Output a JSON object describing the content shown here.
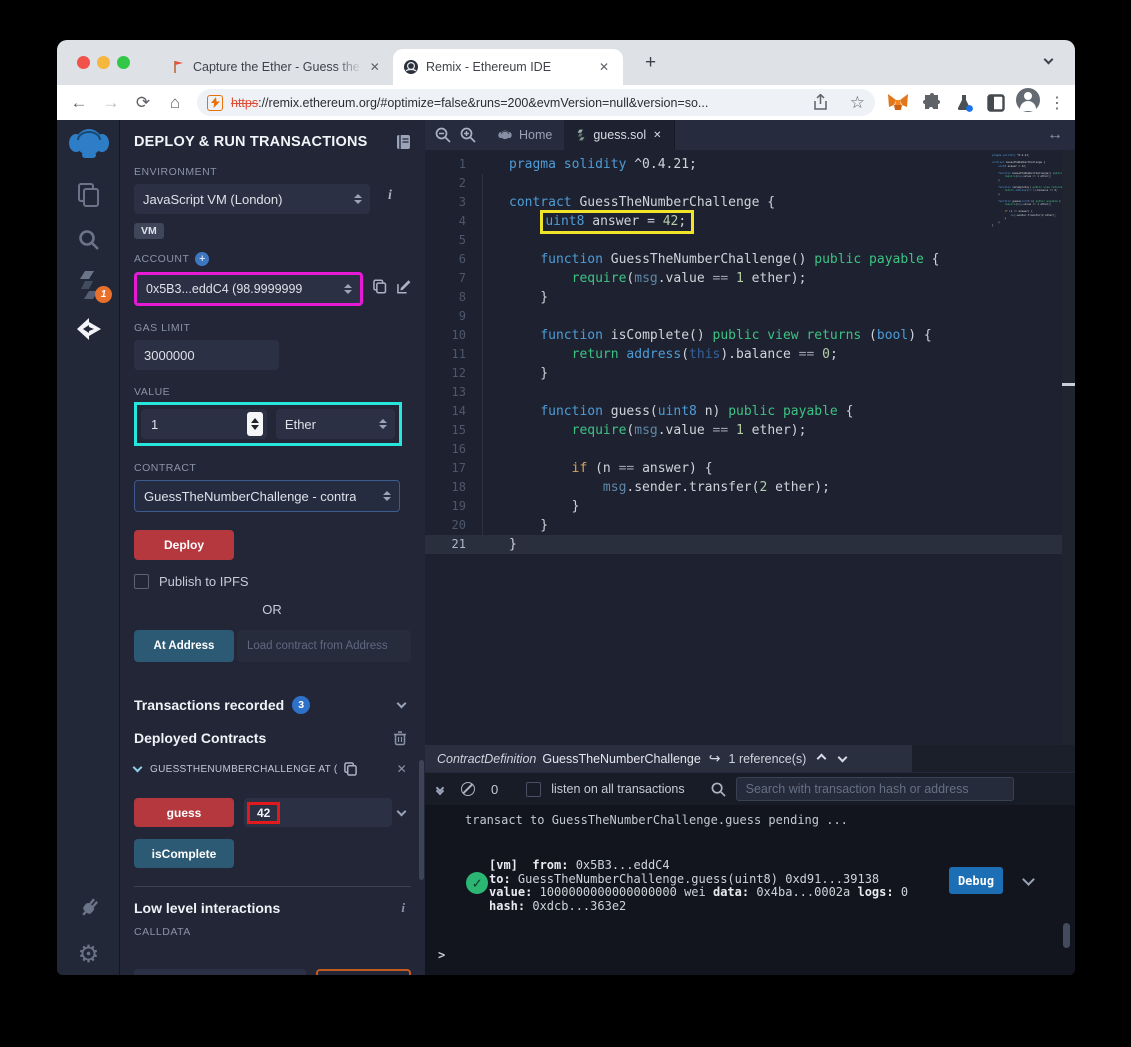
{
  "chrome": {
    "tab1_title": "Capture the Ether - Guess the ",
    "tab2_title": "Remix - Ethereum IDE",
    "new_tab": "+",
    "close_glyph": "✕",
    "url_https": "https",
    "url_rest": "://remix.ethereum.org/#optimize=false&runs=200&evmVersion=null&version=so..."
  },
  "activity_bar": {
    "compiler_badge": "1"
  },
  "panel": {
    "title": "DEPLOY & RUN TRANSACTIONS",
    "environment_label": "ENVIRONMENT",
    "environment_value": "JavaScript VM (London)",
    "vm_badge": "VM",
    "account_label": "ACCOUNT",
    "account_value": "0x5B3...eddC4 (98.9999999",
    "gas_label": "GAS LIMIT",
    "gas_value": "3000000",
    "value_label": "VALUE",
    "value_amount": "1",
    "value_unit": "Ether",
    "contract_label": "CONTRACT",
    "contract_value": "GuessTheNumberChallenge - contra",
    "deploy_label": "Deploy",
    "publish_label": "Publish to IPFS",
    "or_label": "OR",
    "at_address_label": "At Address",
    "at_address_placeholder": "Load contract from Address",
    "tx_recorded_label": "Transactions recorded",
    "tx_count": "3",
    "deployed_label": "Deployed Contracts",
    "card_title": "GUESSTHENUMBERCHALLENGE AT (",
    "guess_label": "guess",
    "guess_value": "42",
    "is_complete_label": "isComplete",
    "low_level_label": "Low level interactions",
    "calldata_label": "CALLDATA",
    "info_glyph": "i"
  },
  "editor": {
    "home_tab": "Home",
    "file_tab": "guess.sol",
    "lines": [
      {
        "n": "1",
        "t": [
          [
            "kw",
            "pragma solidity"
          ],
          [
            "pl",
            " ^0.4.21;"
          ]
        ]
      },
      {
        "n": "2",
        "t": []
      },
      {
        "n": "3",
        "t": [
          [
            "kw",
            "contract"
          ],
          [
            "pl",
            " GuessTheNumberChallenge {"
          ]
        ]
      },
      {
        "n": "4",
        "box": true,
        "t": [
          [
            "pl",
            "    "
          ],
          [
            "kw",
            "uint8"
          ],
          [
            "pl",
            " answer = "
          ],
          [
            "num",
            "42"
          ],
          [
            "pl",
            ";"
          ]
        ]
      },
      {
        "n": "5",
        "t": []
      },
      {
        "n": "6",
        "t": [
          [
            "pl",
            "    "
          ],
          [
            "kw",
            "function"
          ],
          [
            "pl",
            " GuessTheNumberChallenge() "
          ],
          [
            "grn",
            "public payable"
          ],
          [
            "pl",
            " {"
          ]
        ]
      },
      {
        "n": "7",
        "t": [
          [
            "pl",
            "        "
          ],
          [
            "grn",
            "require"
          ],
          [
            "pl",
            "("
          ],
          [
            "msg",
            "msg"
          ],
          [
            "pl",
            ".value "
          ],
          [
            "op",
            "=="
          ],
          [
            "pl",
            " "
          ],
          [
            "num",
            "1"
          ],
          [
            "pl",
            " ether);"
          ]
        ]
      },
      {
        "n": "8",
        "t": [
          [
            "pl",
            "    }"
          ]
        ]
      },
      {
        "n": "9",
        "t": []
      },
      {
        "n": "10",
        "t": [
          [
            "pl",
            "    "
          ],
          [
            "kw",
            "function"
          ],
          [
            "pl",
            " isComplete() "
          ],
          [
            "grn",
            "public view returns"
          ],
          [
            "pl",
            " ("
          ],
          [
            "kw",
            "bool"
          ],
          [
            "pl",
            ") {"
          ]
        ]
      },
      {
        "n": "11",
        "t": [
          [
            "pl",
            "        "
          ],
          [
            "grn",
            "return"
          ],
          [
            "pl",
            " "
          ],
          [
            "kw",
            "address"
          ],
          [
            "pl",
            "("
          ],
          [
            "ths",
            "this"
          ],
          [
            "pl",
            ").balance "
          ],
          [
            "op",
            "=="
          ],
          [
            "pl",
            " "
          ],
          [
            "num",
            "0"
          ],
          [
            "pl",
            ";"
          ]
        ]
      },
      {
        "n": "12",
        "t": [
          [
            "pl",
            "    }"
          ]
        ]
      },
      {
        "n": "13",
        "t": []
      },
      {
        "n": "14",
        "t": [
          [
            "pl",
            "    "
          ],
          [
            "kw",
            "function"
          ],
          [
            "pl",
            " guess("
          ],
          [
            "kw",
            "uint8"
          ],
          [
            "pl",
            " n) "
          ],
          [
            "grn",
            "public payable"
          ],
          [
            "pl",
            " {"
          ]
        ]
      },
      {
        "n": "15",
        "t": [
          [
            "pl",
            "        "
          ],
          [
            "grn",
            "require"
          ],
          [
            "pl",
            "("
          ],
          [
            "msg",
            "msg"
          ],
          [
            "pl",
            ".value "
          ],
          [
            "op",
            "=="
          ],
          [
            "pl",
            " "
          ],
          [
            "num",
            "1"
          ],
          [
            "pl",
            " ether);"
          ]
        ]
      },
      {
        "n": "16",
        "t": []
      },
      {
        "n": "17",
        "t": [
          [
            "pl",
            "        "
          ],
          [
            "ctl",
            "if"
          ],
          [
            "pl",
            " (n "
          ],
          [
            "op",
            "=="
          ],
          [
            "pl",
            " answer) {"
          ]
        ]
      },
      {
        "n": "18",
        "t": [
          [
            "pl",
            "            "
          ],
          [
            "msg",
            "msg"
          ],
          [
            "pl",
            ".sender.transfer("
          ],
          [
            "num",
            "2"
          ],
          [
            "pl",
            " ether);"
          ]
        ]
      },
      {
        "n": "19",
        "t": [
          [
            "pl",
            "        }"
          ]
        ]
      },
      {
        "n": "20",
        "t": [
          [
            "pl",
            "    }"
          ]
        ]
      },
      {
        "n": "21",
        "active": true,
        "t": [
          [
            "pl",
            "}"
          ]
        ]
      }
    ]
  },
  "defbar": {
    "kind": "ContractDefinition",
    "name": "GuessTheNumberChallenge",
    "refs": "1 reference(s)"
  },
  "terminal": {
    "count": "0",
    "listen_label": "listen on all transactions",
    "search_placeholder": "Search with transaction hash or address",
    "pending_line": "transact to GuessTheNumberChallenge.guess pending ...",
    "log": [
      [
        [
          "b",
          "[vm]"
        ],
        [
          "pl",
          "  "
        ],
        [
          "b",
          "from:"
        ],
        [
          "pl",
          " 0x5B3...eddC4"
        ]
      ],
      [
        [
          "b",
          "to:"
        ],
        [
          "pl",
          " GuessTheNumberChallenge.guess(uint8) 0xd91...39138"
        ]
      ],
      [
        [
          "b",
          "value:"
        ],
        [
          "pl",
          " 1000000000000000000 wei "
        ],
        [
          "b",
          "data:"
        ],
        [
          "pl",
          " 0x4ba...0002a "
        ],
        [
          "b",
          "logs:"
        ],
        [
          "pl",
          " 0"
        ]
      ],
      [
        [
          "b",
          "hash:"
        ],
        [
          "pl",
          " 0xdcb...363e2"
        ]
      ]
    ],
    "check_glyph": "✓",
    "debug_label": "Debug",
    "prompt": ">"
  }
}
